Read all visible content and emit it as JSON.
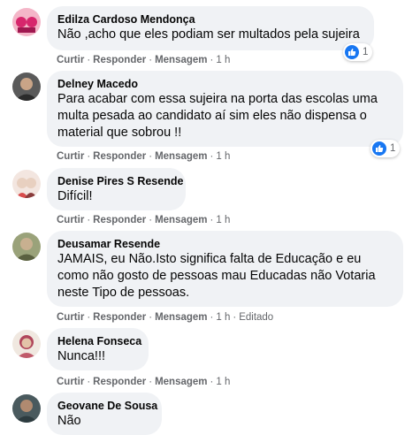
{
  "actions": {
    "like": "Curtir",
    "reply": "Responder",
    "message": "Mensagem",
    "dot": "·"
  },
  "comments": [
    {
      "author": "Edilza Cardoso Mendonça",
      "text": "Não ,acho que eles podiam ser multados pela sujeira",
      "time": "1 h",
      "reactions": {
        "icon": "like-icon",
        "count": "1"
      },
      "avatar_colors": [
        "#d7266c",
        "#f4b6c8"
      ]
    },
    {
      "author": "Delney Macedo",
      "text": "Para acabar com essa sujeira na porta das escolas uma multa pesada ao candidato aí sim eles não dispensa o material que sobrou !!",
      "time": "1 h",
      "reactions": {
        "icon": "like-icon",
        "count": "1"
      },
      "avatar_colors": [
        "#3a3a3a",
        "#c9a487"
      ]
    },
    {
      "author": "Denise Pires S Resende",
      "text": "Difícil!",
      "time": "1 h",
      "avatar_colors": [
        "#d94c4c",
        "#e8d0c0"
      ]
    },
    {
      "author": "Deusamar Resende",
      "text": "JAMAIS, eu Não.Isto significa falta de Educação e eu como não gosto de pessoas mau Educadas não Votaria neste Tipo de pessoas.",
      "time": "1 h",
      "edited": "Editado",
      "avatar_colors": [
        "#7d8a5a",
        "#c8b090"
      ]
    },
    {
      "author": "Helena Fonseca",
      "text": "Nunca!!!",
      "time": "1 h",
      "avatar_colors": [
        "#b0455a",
        "#e3c3a8"
      ]
    },
    {
      "author": "Geovane De Sousa",
      "text": "Não",
      "avatar_colors": [
        "#2d3b3f",
        "#b08a70"
      ]
    }
  ]
}
